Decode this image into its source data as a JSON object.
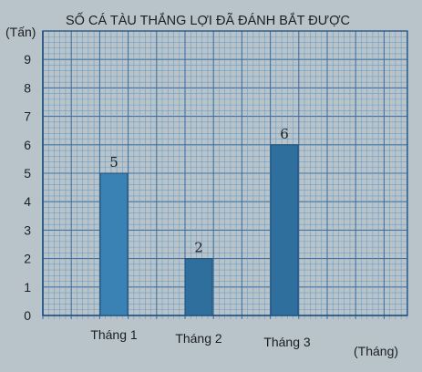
{
  "chart_data": {
    "type": "bar",
    "title": "SỐ CÁ TÀU THẮNG LỢI ĐÃ ĐÁNH BẮT ĐƯỢC",
    "ylabel": "(Tấn)",
    "xlabel": "(Tháng)",
    "categories": [
      "Tháng 1",
      "Tháng 2",
      "Tháng 3"
    ],
    "values": [
      5,
      2,
      6
    ],
    "data_labels": [
      "5",
      "2",
      "6"
    ],
    "ylim": [
      0,
      10
    ],
    "yticks": [
      "0",
      "1",
      "2",
      "3",
      "4",
      "5",
      "6",
      "7",
      "8",
      "9"
    ],
    "grid": true,
    "colors": {
      "bar": "#2e6f9e",
      "bar_first": "#3a82b3",
      "grid_minor": "#5a92c2",
      "grid_major": "#3a6fa3",
      "axis": "#1e4f82",
      "background": "#b9c4ca"
    }
  }
}
